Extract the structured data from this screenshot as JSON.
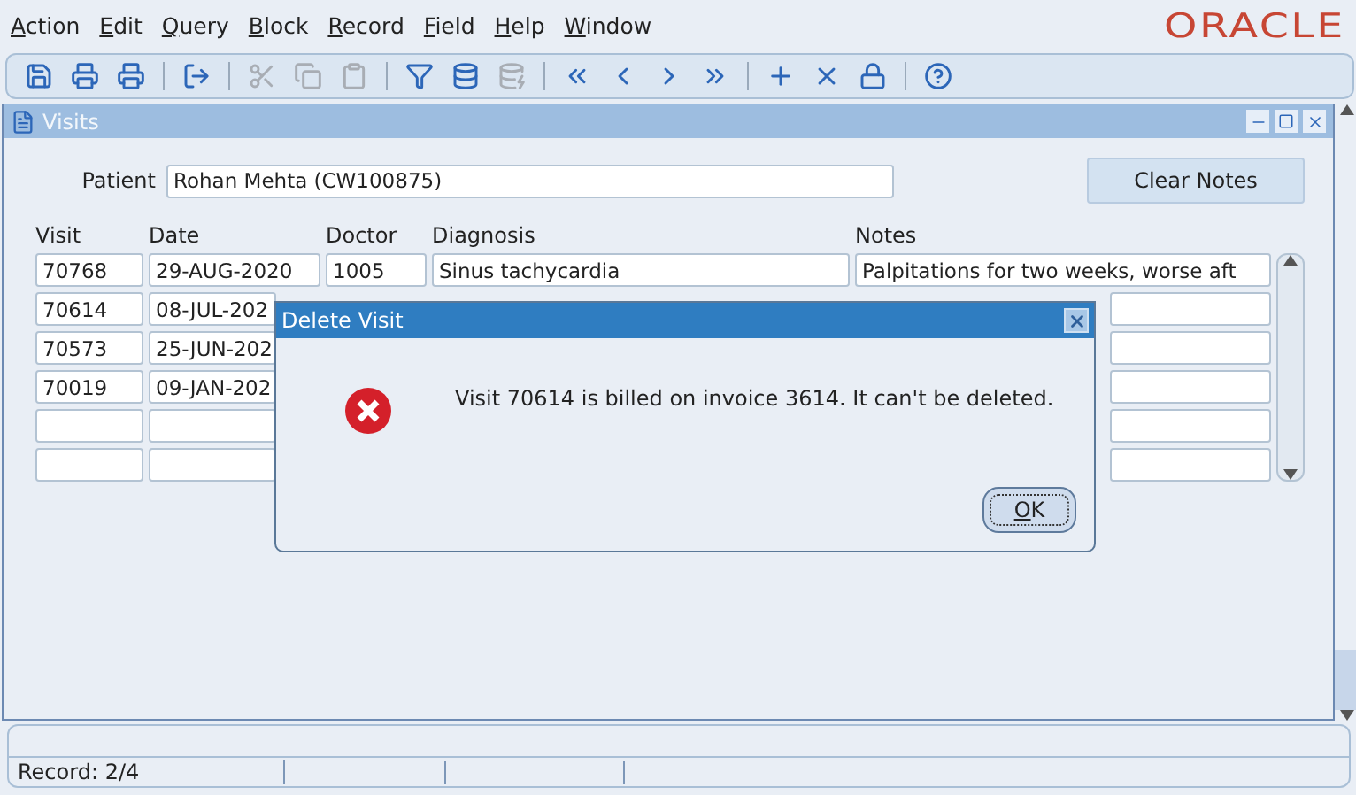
{
  "menu": [
    "Action",
    "Edit",
    "Query",
    "Block",
    "Record",
    "Field",
    "Help",
    "Window"
  ],
  "logo": "ORACLE",
  "toolbar": [
    [
      {
        "kind": "save",
        "disabled": false
      },
      {
        "kind": "print",
        "disabled": false
      },
      {
        "kind": "print-setup",
        "disabled": false
      }
    ],
    [
      {
        "kind": "exit",
        "disabled": false
      }
    ],
    [
      {
        "kind": "cut",
        "disabled": true
      },
      {
        "kind": "copy",
        "disabled": true
      },
      {
        "kind": "paste",
        "disabled": true
      }
    ],
    [
      {
        "kind": "enter-query",
        "disabled": false
      },
      {
        "kind": "execute-query",
        "disabled": false
      },
      {
        "kind": "cancel-query",
        "disabled": true
      }
    ],
    [
      {
        "kind": "first",
        "disabled": false
      },
      {
        "kind": "previous",
        "disabled": false
      },
      {
        "kind": "next",
        "disabled": false
      },
      {
        "kind": "last",
        "disabled": false
      }
    ],
    [
      {
        "kind": "insert",
        "disabled": false
      },
      {
        "kind": "delete",
        "disabled": false
      },
      {
        "kind": "lock",
        "disabled": false
      }
    ],
    [
      {
        "kind": "help",
        "disabled": false
      }
    ]
  ],
  "window": {
    "title": "Visits"
  },
  "patient": {
    "label": "Patient",
    "value": "Rohan Mehta  (CW100875)"
  },
  "clear_button": "Clear Notes",
  "table": {
    "columns": [
      "Visit",
      "Date",
      "Doctor",
      "Diagnosis",
      "Notes"
    ],
    "rows": [
      {
        "visit": "70768",
        "date": "29-AUG-2020",
        "doctor": "1005",
        "diagnosis": "Sinus tachycardia",
        "notes": "Palpitations for two weeks, worse aft"
      },
      {
        "visit": "70614",
        "date": "08-JUL-202"
      },
      {
        "visit": "70573",
        "date": "25-JUN-202"
      },
      {
        "visit": "70019",
        "date": "09-JAN-202"
      }
    ]
  },
  "dialog": {
    "title": "Delete Visit",
    "message": "Visit 70614 is billed on invoice 3614. It can't be deleted.",
    "button": "OK"
  },
  "status_bar": {
    "record": "Record: 2/4"
  }
}
